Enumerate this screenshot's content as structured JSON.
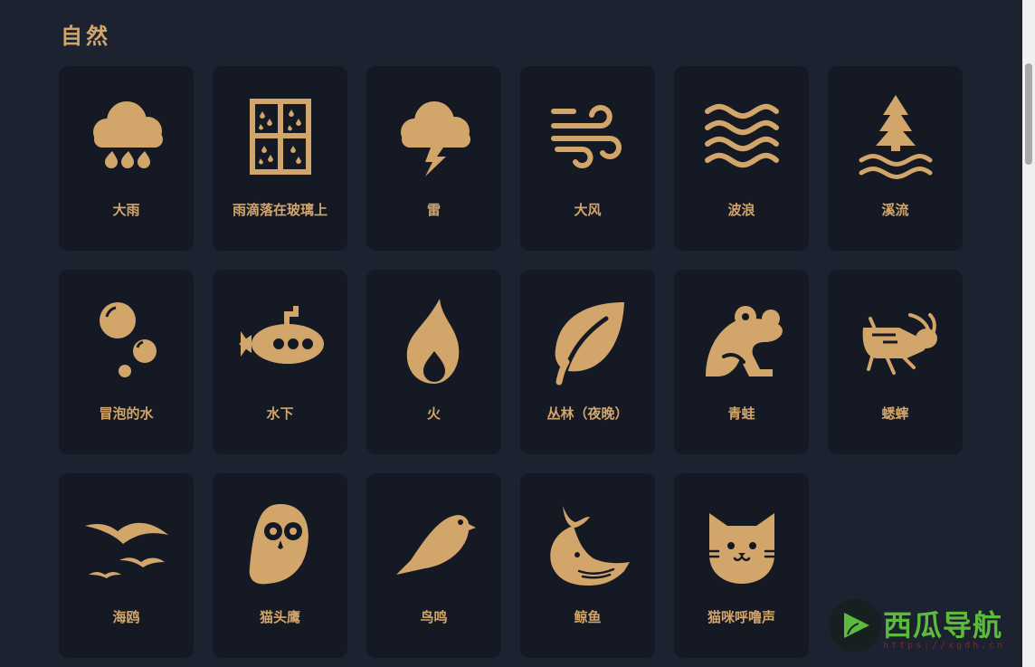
{
  "section": {
    "title": "自然"
  },
  "cards": [
    {
      "label": "大雨",
      "icon": "heavy-rain-icon"
    },
    {
      "label": "雨滴落在玻璃上",
      "icon": "rain-on-window-icon"
    },
    {
      "label": "雷",
      "icon": "thunder-icon"
    },
    {
      "label": "大风",
      "icon": "wind-icon"
    },
    {
      "label": "波浪",
      "icon": "waves-icon"
    },
    {
      "label": "溪流",
      "icon": "stream-icon"
    },
    {
      "label": "冒泡的水",
      "icon": "bubbles-icon"
    },
    {
      "label": "水下",
      "icon": "submarine-icon"
    },
    {
      "label": "火",
      "icon": "fire-icon"
    },
    {
      "label": "丛林（夜晚）",
      "icon": "leaf-icon"
    },
    {
      "label": "青蛙",
      "icon": "frog-icon"
    },
    {
      "label": "蟋蟀",
      "icon": "cricket-icon"
    },
    {
      "label": "海鸥",
      "icon": "seagulls-icon"
    },
    {
      "label": "猫头鹰",
      "icon": "owl-icon"
    },
    {
      "label": "鸟鸣",
      "icon": "bird-icon"
    },
    {
      "label": "鲸鱼",
      "icon": "whale-icon"
    },
    {
      "label": "猫咪呼噜声",
      "icon": "cat-icon"
    }
  ],
  "watermark": {
    "brand": "西瓜导航",
    "url": "https://xgdh.cn"
  },
  "colors": {
    "background": "#1c2230",
    "card": "#141923",
    "accent": "#d2a56b"
  }
}
